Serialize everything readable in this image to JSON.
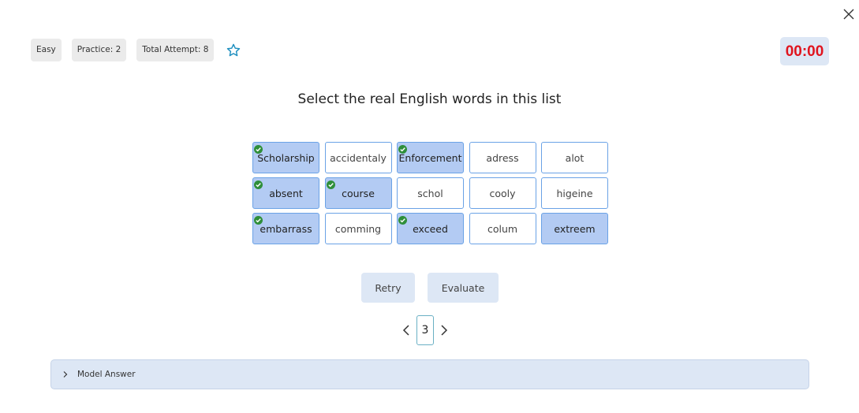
{
  "header": {
    "chips": [
      {
        "name": "difficulty-chip",
        "label": "Easy"
      },
      {
        "name": "practice-chip",
        "label": "Practice: 2"
      },
      {
        "name": "total-attempt-chip",
        "label": "Total Attempt: 8"
      }
    ],
    "star_icon": "star-outline-icon",
    "timer": "00:00"
  },
  "question": "Select the real English words in this list",
  "words": [
    {
      "text": "Scholarship",
      "selected": true,
      "checked": true
    },
    {
      "text": "accidentaly",
      "selected": false,
      "checked": false
    },
    {
      "text": "Enforcement",
      "selected": true,
      "checked": true
    },
    {
      "text": "adress",
      "selected": false,
      "checked": false
    },
    {
      "text": "alot",
      "selected": false,
      "checked": false
    },
    {
      "text": "absent",
      "selected": true,
      "checked": true
    },
    {
      "text": "course",
      "selected": true,
      "checked": true
    },
    {
      "text": "schol",
      "selected": false,
      "checked": false
    },
    {
      "text": "cooly",
      "selected": false,
      "checked": false
    },
    {
      "text": "higeine",
      "selected": false,
      "checked": false
    },
    {
      "text": "embarrass",
      "selected": true,
      "checked": true
    },
    {
      "text": "comming",
      "selected": false,
      "checked": false
    },
    {
      "text": "exceed",
      "selected": true,
      "checked": true
    },
    {
      "text": "colum",
      "selected": false,
      "checked": false
    },
    {
      "text": "extreem",
      "selected": true,
      "checked": false
    }
  ],
  "actions": {
    "retry": "Retry",
    "evaluate": "Evaluate"
  },
  "pagination": {
    "current": "3"
  },
  "model_answer": {
    "label": "Model Answer"
  },
  "colors": {
    "selected_bg": "#b3cbf3",
    "word_border": "#6aa2e6",
    "timer_text": "#e0141e",
    "panel_bg": "#dde7f5",
    "check_green": "#2f8f3a",
    "star": "#1e8fbf"
  }
}
